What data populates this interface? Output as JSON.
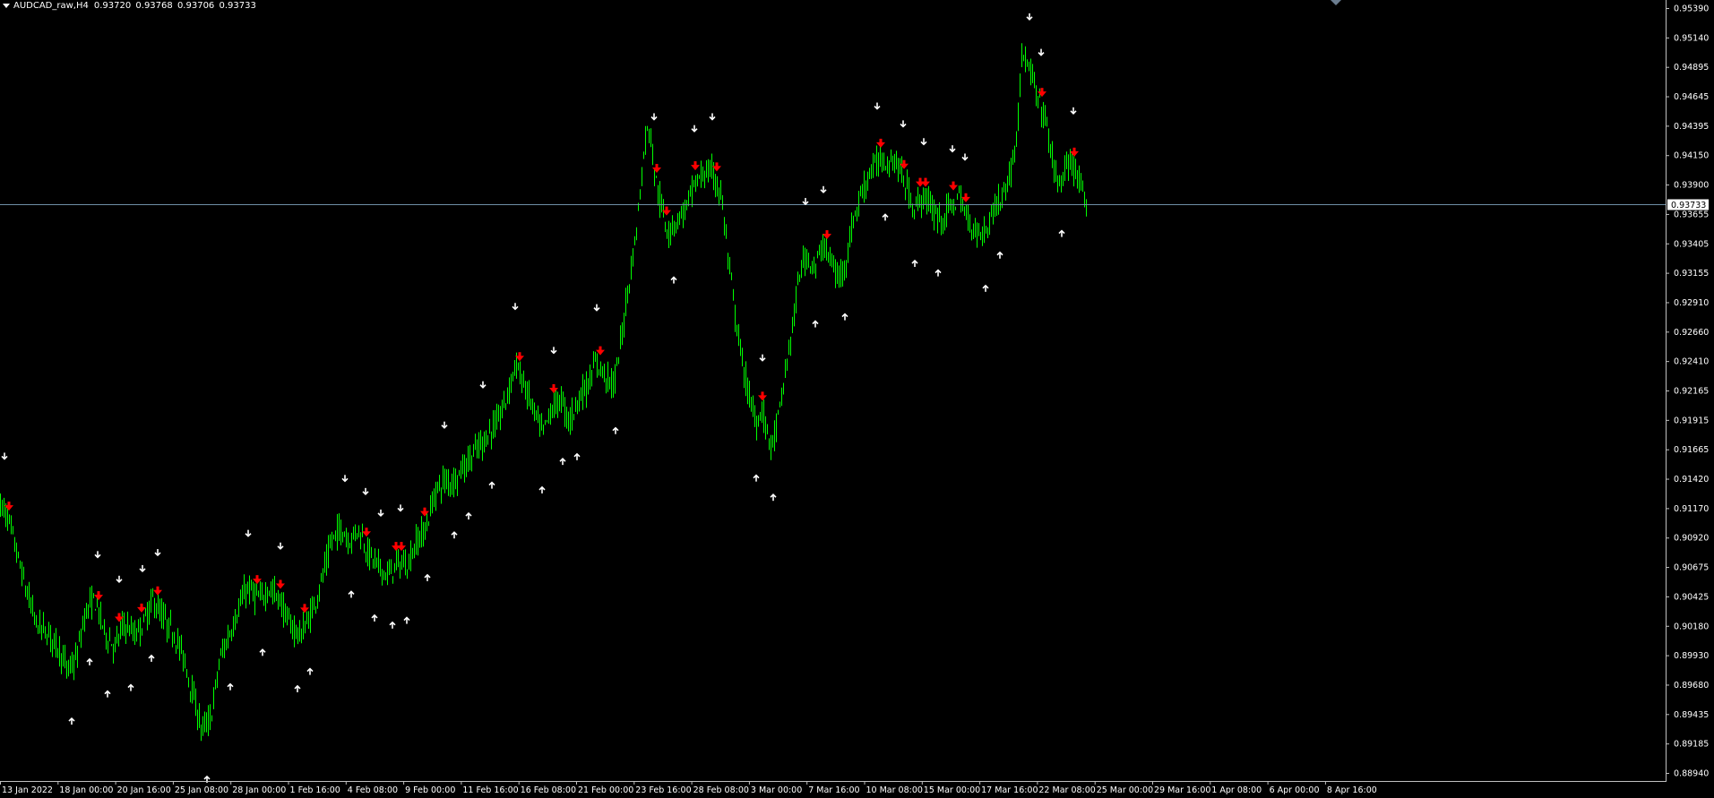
{
  "header": {
    "symbol": "AUDCAD_raw,H4",
    "ohlc": "0.93720 0.93768 0.93706 0.93733"
  },
  "colors": {
    "background": "#000000",
    "candle": "#00ff00",
    "axis_line": "#c0c0c0",
    "text": "#ffffff",
    "bid_line": "#6f8fa6",
    "sell_arrow": "#ff0000",
    "fractal_arrow": "#ffffff"
  },
  "icons": {
    "sell_signal": "red-down-arrow-icon",
    "fractal_up": "white-up-arrow-icon",
    "fractal_down": "white-down-arrow-icon",
    "menu": "triangle-down-icon",
    "scroll": "scroll-marker-icon"
  },
  "price_axis": {
    "labels": [
      "0.95390",
      "0.95140",
      "0.94895",
      "0.94645",
      "0.94395",
      "0.94150",
      "0.93900",
      "0.93655",
      "0.93405",
      "0.93155",
      "0.92910",
      "0.92660",
      "0.92410",
      "0.92165",
      "0.91915",
      "0.91665",
      "0.91420",
      "0.91170",
      "0.90920",
      "0.90675",
      "0.90425",
      "0.90180",
      "0.89930",
      "0.89680",
      "0.89435",
      "0.89185",
      "0.88940"
    ],
    "current_price": "0.93733"
  },
  "time_axis": {
    "labels": [
      "13 Jan 2022",
      "18 Jan 00:00",
      "20 Jan 16:00",
      "25 Jan 08:00",
      "28 Jan 00:00",
      "1 Feb 16:00",
      "4 Feb 08:00",
      "9 Feb 00:00",
      "11 Feb 16:00",
      "16 Feb 08:00",
      "21 Feb 00:00",
      "23 Feb 16:00",
      "28 Feb 08:00",
      "3 Mar 00:00",
      "7 Mar 16:00",
      "10 Mar 08:00",
      "15 Mar 00:00",
      "17 Mar 16:00",
      "22 Mar 08:00",
      "25 Mar 00:00",
      "29 Mar 16:00",
      "1 Apr 08:00",
      "6 Apr 00:00",
      "8 Apr 16:00"
    ]
  },
  "chart_data": {
    "type": "candlestick",
    "symbol": "AUDCAD_raw",
    "timeframe": "H4",
    "ylim": [
      0.8894,
      0.9539
    ],
    "current_price": 0.93733,
    "path": [
      [
        0,
        0.912
      ],
      [
        8,
        0.911
      ],
      [
        18,
        0.908
      ],
      [
        28,
        0.905
      ],
      [
        40,
        0.902
      ],
      [
        55,
        0.901
      ],
      [
        65,
        0.9
      ],
      [
        75,
        0.898
      ],
      [
        85,
        0.899
      ],
      [
        95,
        0.903
      ],
      [
        105,
        0.904
      ],
      [
        118,
        0.901
      ],
      [
        128,
        0.9
      ],
      [
        138,
        0.902
      ],
      [
        150,
        0.901
      ],
      [
        160,
        0.902
      ],
      [
        170,
        0.904
      ],
      [
        178,
        0.903
      ],
      [
        185,
        0.902
      ],
      [
        195,
        0.901
      ],
      [
        205,
        0.899
      ],
      [
        215,
        0.896
      ],
      [
        225,
        0.893
      ],
      [
        235,
        0.894
      ],
      [
        245,
        0.899
      ],
      [
        255,
        0.901
      ],
      [
        265,
        0.903
      ],
      [
        275,
        0.905
      ],
      [
        290,
        0.904
      ],
      [
        300,
        0.905
      ],
      [
        312,
        0.904
      ],
      [
        322,
        0.902
      ],
      [
        335,
        0.901
      ],
      [
        348,
        0.903
      ],
      [
        360,
        0.906
      ],
      [
        370,
        0.909
      ],
      [
        380,
        0.91
      ],
      [
        390,
        0.909
      ],
      [
        400,
        0.91
      ],
      [
        410,
        0.908
      ],
      [
        420,
        0.907
      ],
      [
        432,
        0.906
      ],
      [
        442,
        0.907
      ],
      [
        455,
        0.907
      ],
      [
        465,
        0.909
      ],
      [
        475,
        0.91
      ],
      [
        485,
        0.913
      ],
      [
        495,
        0.914
      ],
      [
        505,
        0.914
      ],
      [
        515,
        0.915
      ],
      [
        525,
        0.916
      ],
      [
        535,
        0.917
      ],
      [
        545,
        0.918
      ],
      [
        555,
        0.919
      ],
      [
        565,
        0.921
      ],
      [
        575,
        0.924
      ],
      [
        585,
        0.922
      ],
      [
        595,
        0.92
      ],
      [
        605,
        0.918
      ],
      [
        615,
        0.92
      ],
      [
        625,
        0.921
      ],
      [
        635,
        0.919
      ],
      [
        645,
        0.921
      ],
      [
        655,
        0.922
      ],
      [
        665,
        0.924
      ],
      [
        675,
        0.923
      ],
      [
        685,
        0.922
      ],
      [
        693,
        0.926
      ],
      [
        700,
        0.93
      ],
      [
        708,
        0.934
      ],
      [
        715,
        0.939
      ],
      [
        720,
        0.943
      ],
      [
        725,
        0.944
      ],
      [
        730,
        0.94
      ],
      [
        738,
        0.937
      ],
      [
        745,
        0.935
      ],
      [
        755,
        0.936
      ],
      [
        765,
        0.937
      ],
      [
        775,
        0.939
      ],
      [
        785,
        0.94
      ],
      [
        795,
        0.94
      ],
      [
        805,
        0.938
      ],
      [
        812,
        0.933
      ],
      [
        820,
        0.928
      ],
      [
        828,
        0.924
      ],
      [
        836,
        0.921
      ],
      [
        844,
        0.919
      ],
      [
        850,
        0.92
      ],
      [
        856,
        0.918
      ],
      [
        862,
        0.917
      ],
      [
        870,
        0.92
      ],
      [
        878,
        0.924
      ],
      [
        886,
        0.928
      ],
      [
        893,
        0.932
      ],
      [
        900,
        0.933
      ],
      [
        910,
        0.932
      ],
      [
        918,
        0.934
      ],
      [
        925,
        0.933
      ],
      [
        935,
        0.931
      ],
      [
        945,
        0.933
      ],
      [
        952,
        0.936
      ],
      [
        960,
        0.938
      ],
      [
        970,
        0.94
      ],
      [
        980,
        0.941
      ],
      [
        990,
        0.941
      ],
      [
        1000,
        0.941
      ],
      [
        1010,
        0.939
      ],
      [
        1020,
        0.937
      ],
      [
        1030,
        0.938
      ],
      [
        1040,
        0.937
      ],
      [
        1050,
        0.936
      ],
      [
        1060,
        0.937
      ],
      [
        1070,
        0.938
      ],
      [
        1080,
        0.936
      ],
      [
        1090,
        0.935
      ],
      [
        1100,
        0.935
      ],
      [
        1108,
        0.937
      ],
      [
        1118,
        0.938
      ],
      [
        1128,
        0.94
      ],
      [
        1135,
        0.944
      ],
      [
        1140,
        0.95
      ],
      [
        1145,
        0.949
      ],
      [
        1152,
        0.948
      ],
      [
        1158,
        0.946
      ],
      [
        1165,
        0.945
      ],
      [
        1172,
        0.942
      ],
      [
        1180,
        0.939
      ],
      [
        1188,
        0.94
      ],
      [
        1196,
        0.941
      ],
      [
        1204,
        0.939
      ],
      [
        1212,
        0.937
      ]
    ],
    "sell_arrows_x": [
      10,
      110,
      133,
      158,
      176,
      287,
      313,
      340,
      409,
      442,
      448,
      474,
      580,
      618,
      670,
      733,
      744,
      776,
      800,
      851,
      923,
      983,
      1009,
      1027,
      1033,
      1064,
      1078,
      1163,
      1199
    ],
    "fractal_down_x": [
      5,
      109,
      133,
      159,
      176,
      277,
      313,
      385,
      408,
      425,
      447,
      496,
      539,
      575,
      618,
      666,
      730,
      775,
      795,
      851,
      899,
      919,
      979,
      1008,
      1031,
      1063,
      1077,
      1149,
      1162,
      1198
    ],
    "fractal_up_x": [
      80,
      100,
      120,
      146,
      169,
      231,
      257,
      293,
      332,
      346,
      392,
      418,
      438,
      454,
      477,
      507,
      523,
      549,
      605,
      628,
      644,
      687,
      752,
      844,
      863,
      910,
      943,
      988,
      1021,
      1047,
      1100,
      1116,
      1185
    ]
  }
}
